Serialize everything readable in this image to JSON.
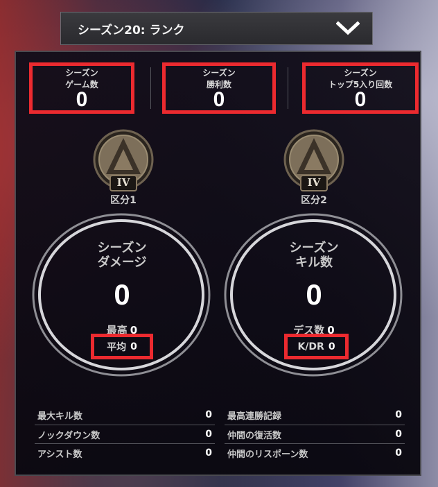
{
  "season_selector": {
    "label": "シーズン20: ランク"
  },
  "header_stats": [
    {
      "label_line1": "シーズン",
      "label_line2": "ゲーム数",
      "value": "0"
    },
    {
      "label_line1": "シーズン",
      "label_line2": "勝利数",
      "value": "0"
    },
    {
      "label_line1": "シーズン",
      "label_line2": "トップ5入り回数",
      "value": "0"
    }
  ],
  "ranks": [
    {
      "tier": "IV",
      "label": "区分1"
    },
    {
      "tier": "IV",
      "label": "区分2"
    }
  ],
  "damage": {
    "title_line1": "シーズン",
    "title_line2": "ダメージ",
    "value": "0",
    "best_label": "最高",
    "best_value": "0",
    "avg_label": "平均",
    "avg_value": "0"
  },
  "kills": {
    "title_line1": "シーズン",
    "title_line2": "キル数",
    "value": "0",
    "deaths_label": "デス数",
    "deaths_value": "0",
    "kdr_label": "K/DR",
    "kdr_value": "0"
  },
  "left_list": [
    {
      "label": "最大キル数",
      "value": "0"
    },
    {
      "label": "ノックダウン数",
      "value": "0"
    },
    {
      "label": "アシスト数",
      "value": "0"
    }
  ],
  "right_list": [
    {
      "label": "最高連勝記録",
      "value": "0"
    },
    {
      "label": "仲間の復活数",
      "value": "0"
    },
    {
      "label": "仲間のリスポーン数",
      "value": "0"
    }
  ],
  "colors": {
    "highlight": "#ec2a2f",
    "badge_bronze": "#8a7a62"
  }
}
